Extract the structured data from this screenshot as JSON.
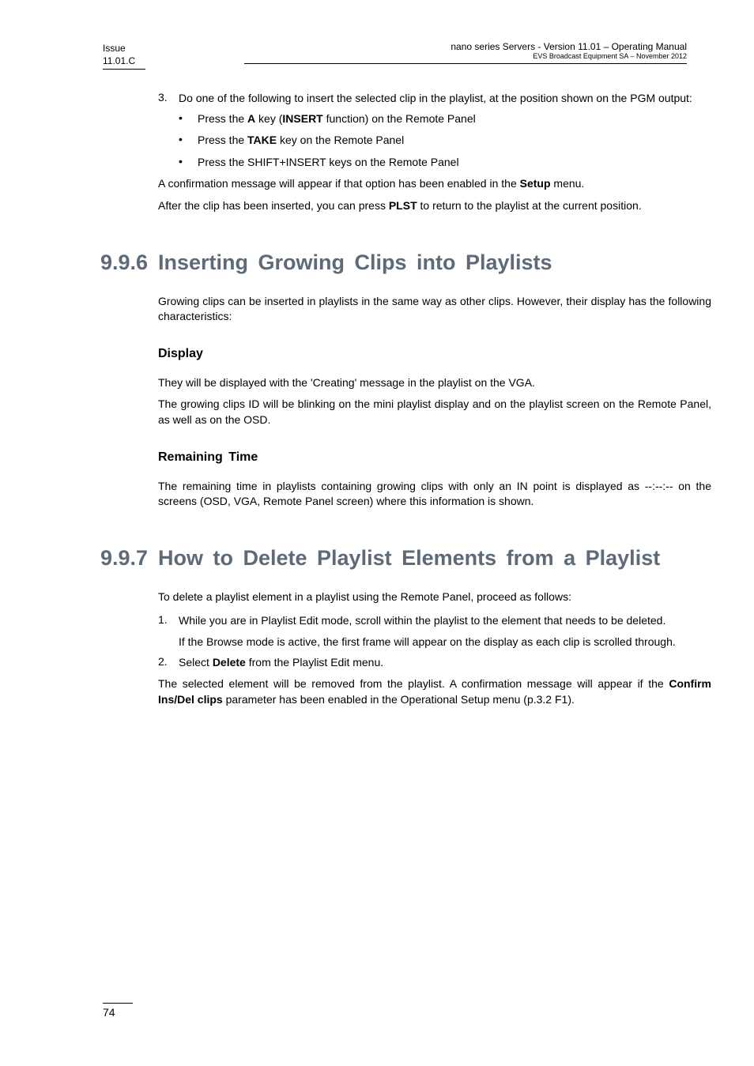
{
  "header": {
    "issue_label": "Issue",
    "issue_value": "11.01.C",
    "right_line1": "nano series Servers - Version 11.01 – Operating Manual",
    "right_line2": "EVS Broadcast Equipment SA – November 2012"
  },
  "step3": {
    "num": "3.",
    "text_prefix": "Do one of the following to insert the selected clip in the playlist, at the position shown on the PGM output:",
    "bullets": {
      "b1_pre": "Press the ",
      "b1_bold1": "A",
      "b1_mid": " key (",
      "b1_bold2": "INSERT",
      "b1_post": " function) on the Remote Panel",
      "b2_pre": "Press the ",
      "b2_bold": "TAKE",
      "b2_post": " key on the Remote Panel",
      "b3": "Press the SHIFT+INSERT keys on the Remote Panel"
    }
  },
  "para1_pre": "A confirmation message will appear if that option has been enabled in the ",
  "para1_bold": "Setup",
  "para1_post": " menu.",
  "para2_pre": "After the clip has been inserted, you can press ",
  "para2_bold": "PLST",
  "para2_post": " to return to the playlist at the current position.",
  "sec996": {
    "num": "9.9.6",
    "title": "Inserting Growing Clips into Playlists",
    "intro": "Growing clips can be inserted in playlists in the same way as other clips. However, their display has the following characteristics:",
    "display_h": "Display",
    "display_p1": "They will be displayed with the 'Creating' message in the playlist on the VGA.",
    "display_p2": "The growing clips ID will be blinking on the mini playlist display and on the playlist screen on the Remote Panel, as well as on the OSD.",
    "remaining_h": "Remaining Time",
    "remaining_p": "The remaining time in playlists containing growing clips with only an IN point is displayed as --:--:-- on the screens (OSD, VGA, Remote Panel screen) where this information is shown."
  },
  "sec997": {
    "num": "9.9.7",
    "title": "How to Delete Playlist Elements from a Playlist",
    "intro": "To delete a playlist element in a playlist using the Remote Panel, proceed as follows:",
    "step1_num": "1.",
    "step1_text": "While you are in Playlist Edit mode, scroll within the playlist to the element that needs to be deleted.",
    "step1_sub": "If the Browse mode is active, the first frame will appear on the display as each clip is scrolled through.",
    "step2_num": "2.",
    "step2_pre": "Select ",
    "step2_bold": "Delete",
    "step2_post": " from the Playlist Edit menu.",
    "closing_pre": "The selected element will be removed from the playlist. A confirmation message will appear if the ",
    "closing_bold": "Confirm Ins/Del clips",
    "closing_post": " parameter has been enabled in the Operational Setup menu (p.3.2 F1)."
  },
  "page_number": "74"
}
